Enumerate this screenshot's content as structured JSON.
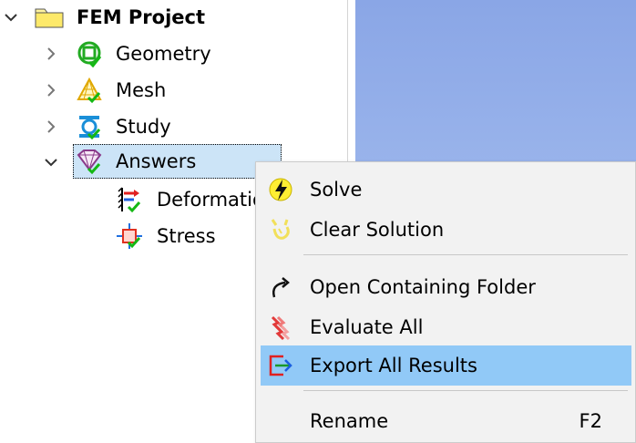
{
  "tree": {
    "root": {
      "label": "FEM Project",
      "icon": "folder-icon",
      "expanded": true
    },
    "items": [
      {
        "label": "Geometry",
        "icon": "geometry-icon",
        "expanded": false
      },
      {
        "label": "Mesh",
        "icon": "mesh-icon",
        "expanded": false
      },
      {
        "label": "Study",
        "icon": "study-icon",
        "expanded": false
      },
      {
        "label": "Answers",
        "icon": "answers-icon",
        "expanded": true,
        "selected": true,
        "children": [
          {
            "label": "Deformatio",
            "icon": "deformation-icon"
          },
          {
            "label": "Stress",
            "icon": "stress-icon"
          }
        ]
      }
    ]
  },
  "context_menu": {
    "items": [
      {
        "label": "Solve",
        "icon": "solve-lightning-icon"
      },
      {
        "label": "Clear Solution",
        "icon": "clear-solution-icon"
      },
      {
        "label": "Open Containing Folder",
        "icon": "open-folder-arrow-icon"
      },
      {
        "label": "Evaluate All",
        "icon": "evaluate-all-icon"
      },
      {
        "label": "Export All Results",
        "icon": "export-icon",
        "highlighted": true
      },
      {
        "label": "Rename",
        "shortcut": "F2"
      }
    ]
  },
  "colors": {
    "selection": "#cce4f7",
    "menu_highlight": "#91c9f7",
    "menu_background": "#f2f2f2",
    "viewport_top": "#8aa6e6",
    "viewport_bottom": "#b9cdf2"
  }
}
